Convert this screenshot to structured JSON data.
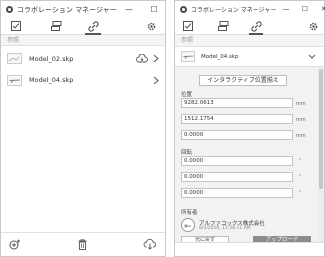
{
  "left": {
    "title": "コラボレーション マネージャー",
    "window": {
      "min": "—",
      "max": "☐",
      "close": "✕"
    },
    "section_label": "参照",
    "items": [
      {
        "label": "Model_02.skp"
      },
      {
        "label": "Model_04.skp"
      }
    ]
  },
  "right": {
    "title": "コラボレーション マネージャー",
    "window": {
      "min": "—",
      "max": "☐",
      "close": "✕"
    },
    "section_label": "参照",
    "selected_item": "Model_04.skp",
    "interactive_button": "インタラクティブ位置揃え",
    "position_label": "位置",
    "position": [
      {
        "value": "9282.0613",
        "unit": "mm"
      },
      {
        "value": "1512.1754",
        "unit": "mm"
      },
      {
        "value": "0.0000",
        "unit": "mm"
      }
    ],
    "rotation_label": "回転",
    "rotation": [
      {
        "value": "0.0000",
        "unit": "°"
      },
      {
        "value": "0.0000",
        "unit": "°"
      },
      {
        "value": "0.0000",
        "unit": "°"
      }
    ],
    "author_label": "所有者",
    "author_name": "アルファコックス株式会社",
    "author_date": "8/3/2016, 11:28:11 AM",
    "cancel_button": "元に戻す",
    "upload_button": "アップロード"
  },
  "colors": {
    "upload_button_bg": "#8c8c8c",
    "scroll_thumb": "#c6c6c6"
  }
}
